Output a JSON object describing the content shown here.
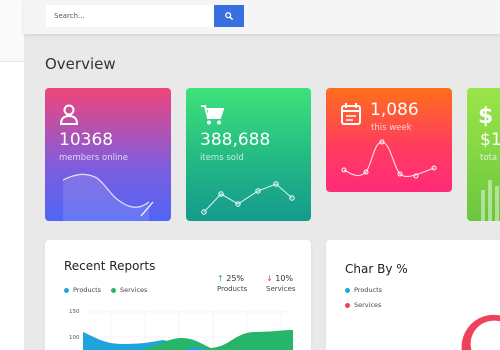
{
  "search": {
    "placeholder": "Search..."
  },
  "page": {
    "title": "Overview"
  },
  "cards": [
    {
      "value": "10368",
      "label": "members online",
      "icon": "user-icon"
    },
    {
      "value": "388,688",
      "label": "items sold",
      "icon": "cart-icon"
    },
    {
      "value": "1,086",
      "label": "this week",
      "icon": "calendar-icon"
    },
    {
      "value": "$1,",
      "label": "tota",
      "icon": "dollar-icon"
    }
  ],
  "colors": {
    "search_button": "#3a6fe0",
    "products": "#1fa4dd",
    "services": "#27b56a",
    "services_pie": "#f0415a"
  },
  "recent_reports": {
    "title": "Recent Reports",
    "legend": [
      {
        "name": "Products",
        "color": "#1fa4dd"
      },
      {
        "name": "Services",
        "color": "#27b56a"
      }
    ],
    "stats": [
      {
        "direction": "up",
        "percent": "25%",
        "label": "Products"
      },
      {
        "direction": "down",
        "percent": "10%",
        "label": "Services"
      }
    ],
    "y_ticks": [
      "150",
      "100"
    ]
  },
  "char_by": {
    "title": "Char By %",
    "legend": [
      {
        "name": "Products",
        "color": "#1fa4dd"
      },
      {
        "name": "Services",
        "color": "#f0415a"
      }
    ]
  }
}
